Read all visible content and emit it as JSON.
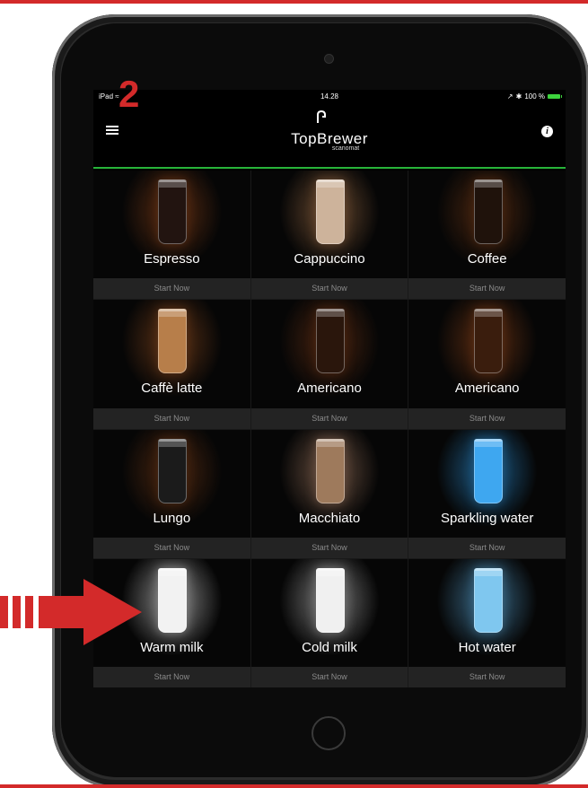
{
  "step_number": "2",
  "status_bar": {
    "device": "iPad",
    "time": "14.28",
    "battery": "100 %"
  },
  "header": {
    "brand": "TopBrewer",
    "brand_sub": "scanomat"
  },
  "colors": {
    "accent_red": "#d32a2a",
    "header_line": "#27b53a"
  },
  "drinks": [
    {
      "name": "Espresso",
      "action": "Start Now",
      "cup": "#221410",
      "glow": "#5a2c12"
    },
    {
      "name": "Cappuccino",
      "action": "Start Now",
      "cup": "#cdb39b",
      "glow": "#6a4a30"
    },
    {
      "name": "Coffee",
      "action": "Start Now",
      "cup": "#1f120b",
      "glow": "#4a2610"
    },
    {
      "name": "Caffè latte",
      "action": "Start Now",
      "cup": "#b77e4a",
      "glow": "#5c3216"
    },
    {
      "name": "Americano",
      "action": "Start Now",
      "cup": "#2a160c",
      "glow": "#4a2410"
    },
    {
      "name": "Americano",
      "action": "Start Now",
      "cup": "#3a1d0d",
      "glow": "#5a2c12"
    },
    {
      "name": "Lungo",
      "action": "Start Now",
      "cup": "#1b1b1b",
      "glow": "#4a2610"
    },
    {
      "name": "Macchiato",
      "action": "Start Now",
      "cup": "#9e7a5c",
      "glow": "#6a5040"
    },
    {
      "name": "Sparkling water",
      "action": "Start Now",
      "cup": "#3ea7f0",
      "glow": "#1f5e8a"
    },
    {
      "name": "Warm milk",
      "action": "Start Now",
      "cup": "#f2f2f2",
      "glow": "#8a8a8a"
    },
    {
      "name": "Cold milk",
      "action": "Start Now",
      "cup": "#f0f0f0",
      "glow": "#7a7a7a"
    },
    {
      "name": "Hot water",
      "action": "Start Now",
      "cup": "#7fc7ef",
      "glow": "#3a6a88"
    }
  ],
  "icons": {
    "menu": "menu-icon",
    "info": "info-icon",
    "wifi": "wifi-icon",
    "bluetooth": "bluetooth-icon",
    "arrow": "arrow-right-icon"
  }
}
